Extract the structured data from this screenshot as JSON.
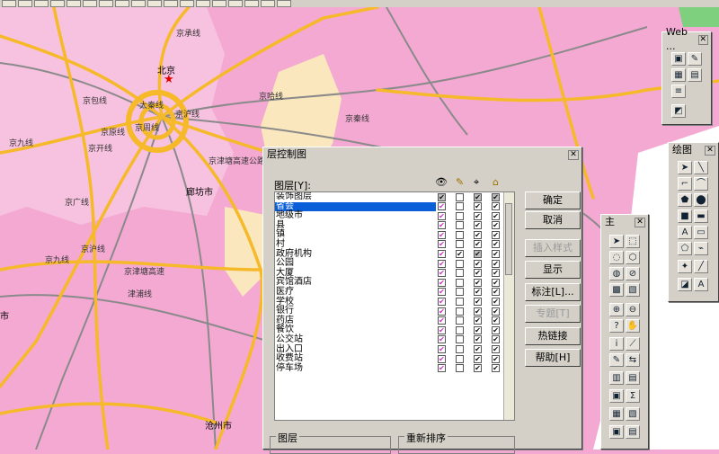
{
  "map": {
    "city_labels": [
      "北京",
      "廊坊市",
      "沧州市",
      "市"
    ],
    "road_labels": [
      "京承线",
      "京包线",
      "京原线",
      "京周线",
      "京开线",
      "京津塘高速公路",
      "京广线",
      "京沪线",
      "京秦线",
      "京哈线",
      "大秦线",
      "京九线",
      "京津塘高速",
      "津浦线",
      "京九线",
      "京沪线"
    ],
    "colors": {
      "province": "#f4a9d3",
      "neighbor": "#fbe7bd",
      "road": "#f5b929",
      "rail": "#8a8a8a",
      "sea": "#ffffff"
    }
  },
  "layer_control": {
    "title": "层控制图",
    "layers_label": "图层[Y]:",
    "column_icons": [
      "eye-icon",
      "pencil-icon",
      "select-icon",
      "tag-icon"
    ],
    "layers": [
      {
        "name": "装饰图层",
        "v": "gray",
        "e": "empty",
        "s": "gray",
        "l": "gray"
      },
      {
        "name": "省会",
        "v": "check",
        "e": "empty",
        "s": "check",
        "l": "check",
        "selected": true
      },
      {
        "name": "地级市",
        "v": "check",
        "e": "empty",
        "s": "check",
        "l": "check"
      },
      {
        "name": "县",
        "v": "check",
        "e": "empty",
        "s": "check",
        "l": "check"
      },
      {
        "name": "镇",
        "v": "check",
        "e": "empty",
        "s": "check",
        "l": "check"
      },
      {
        "name": "村",
        "v": "check",
        "e": "empty",
        "s": "check",
        "l": "check"
      },
      {
        "name": "政府机构",
        "v": "check",
        "e": "check",
        "s": "gray",
        "l": "check"
      },
      {
        "name": "公园",
        "v": "check",
        "e": "empty",
        "s": "check",
        "l": "check"
      },
      {
        "name": "大厦",
        "v": "check",
        "e": "empty",
        "s": "check",
        "l": "check"
      },
      {
        "name": "宾馆酒店",
        "v": "check",
        "e": "empty",
        "s": "check",
        "l": "check"
      },
      {
        "name": "医疗",
        "v": "check",
        "e": "empty",
        "s": "check",
        "l": "check"
      },
      {
        "name": "学校",
        "v": "check",
        "e": "empty",
        "s": "check",
        "l": "check"
      },
      {
        "name": "银行",
        "v": "check",
        "e": "empty",
        "s": "check",
        "l": "check"
      },
      {
        "name": "药店",
        "v": "check",
        "e": "empty",
        "s": "check",
        "l": "check"
      },
      {
        "name": "餐饮",
        "v": "check",
        "e": "empty",
        "s": "check",
        "l": "check"
      },
      {
        "name": "公交站",
        "v": "check",
        "e": "empty",
        "s": "check",
        "l": "check"
      },
      {
        "name": "出入口",
        "v": "check",
        "e": "empty",
        "s": "check",
        "l": "check"
      },
      {
        "name": "收费站",
        "v": "check",
        "e": "empty",
        "s": "check",
        "l": "check"
      },
      {
        "name": "停车场",
        "v": "check",
        "e": "empty",
        "s": "check",
        "l": "check"
      }
    ],
    "buttons": {
      "ok": "确定",
      "cancel": "取消",
      "insert_style": "插入样式",
      "display": "显示",
      "label": "标注[L]...",
      "thematic": "专题[T]",
      "hotlink": "热链接",
      "help": "帮助[H]"
    },
    "group_layers": "图层",
    "group_reorder": "重新排序"
  },
  "web_panel": {
    "title": "Web ..."
  },
  "draw_panel": {
    "title": "绘图"
  },
  "main_panel": {
    "title": "主"
  }
}
